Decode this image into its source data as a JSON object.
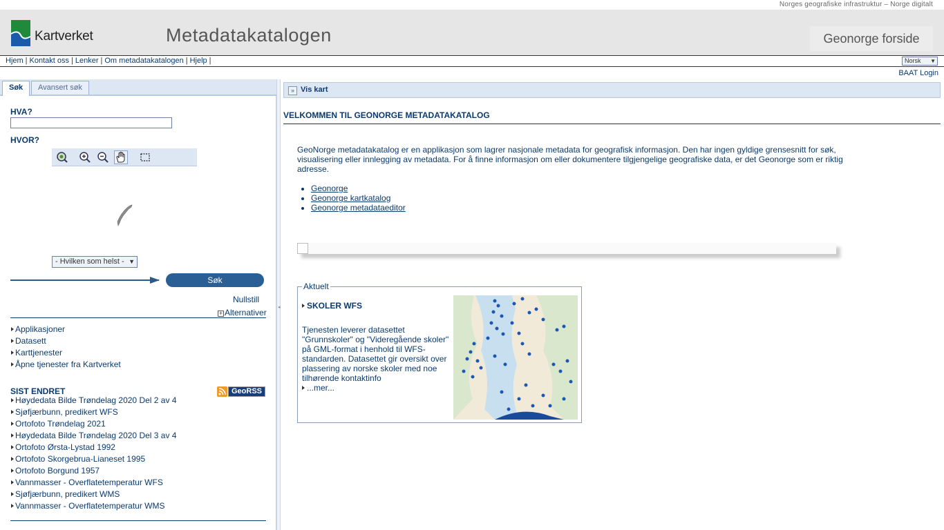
{
  "top": {
    "tagline": "Norges geografiske infrastruktur – Norge digitalt"
  },
  "banner": {
    "logo_text": "Kartverket",
    "app_title": "Metadatakatalogen",
    "home_link": "Geonorge forside"
  },
  "nav": {
    "links": [
      "Hjem",
      "Kontakt oss",
      "Lenker",
      "Om metadatakatalogen",
      "Hjelp"
    ],
    "language": "Norsk",
    "login": "BAAT Login"
  },
  "colors": {
    "brand": "#0a3a6e",
    "button": "#2a5f96",
    "panel": "#dde7f4"
  },
  "search": {
    "tabs": [
      "Søk",
      "Avansert søk"
    ],
    "what_label": "HVA?",
    "what_value": "",
    "where_label": "HVOR?",
    "map_tools": [
      "zoom-extent-icon",
      "zoom-in-icon",
      "zoom-out-icon",
      "pan-hand-icon",
      "select-box-icon"
    ],
    "region_select": "- Hvilken som helst -",
    "search_button": "Søk",
    "reset": "Nullstill",
    "options": "Alternativer"
  },
  "categories": [
    "Applikasjoner",
    "Datasett",
    "Karttjenester",
    "Åpne tjenester fra Kartverket"
  ],
  "recent": {
    "title": "SIST ENDRET",
    "feed_label": "GeoRSS",
    "items": [
      "Høydedata Bilde Trøndelag 2020 Del 2 av 4",
      "Sjøfjærbunn, predikert WFS",
      "Ortofoto Trøndelag 2021",
      "Høydedata Bilde Trøndelag 2020 Del 3 av 4",
      "Ortofoto Ørsta-Lystad 1992",
      "Ortofoto Skorgebrua-Lianeset 1995",
      "Ortofoto Borgund 1957",
      "Vannmasser - Overflatetemperatur WFS",
      "Sjøfjærbunn, predikert WMS",
      "Vannmasser - Overflatetemperatur WMS"
    ]
  },
  "main": {
    "map_toggle": "Vis kart",
    "welcome_title": "VELKOMMEN TIL GEONORGE METADATAKATALOG",
    "intro": "GeoNorge metadatakatalog er en applikasjon som lagrer nasjonale metadata for geografisk informasjon. Den har ingen gyldige grensesnitt for søk, visualisering eller innlegging av metadata. For å finne informasjon om eller dokumentere tilgjengelige geografiske data, er det Geonorge som er riktig adresse.",
    "links": [
      "Geonorge",
      "Geonorge kartkatalog",
      "Geonorge metadataeditor"
    ],
    "news": {
      "legend": "Aktuelt",
      "title": "SKOLER WFS",
      "body": "Tjenesten leverer datasettet \"Grunnskoler\" og \"Videregående skoler\" på GML-format i henhold til WFS-standarden. Datasettet gir oversikt over plassering av norske skoler med noe tilhørende kontaktinfo",
      "more": "...mer..."
    }
  }
}
